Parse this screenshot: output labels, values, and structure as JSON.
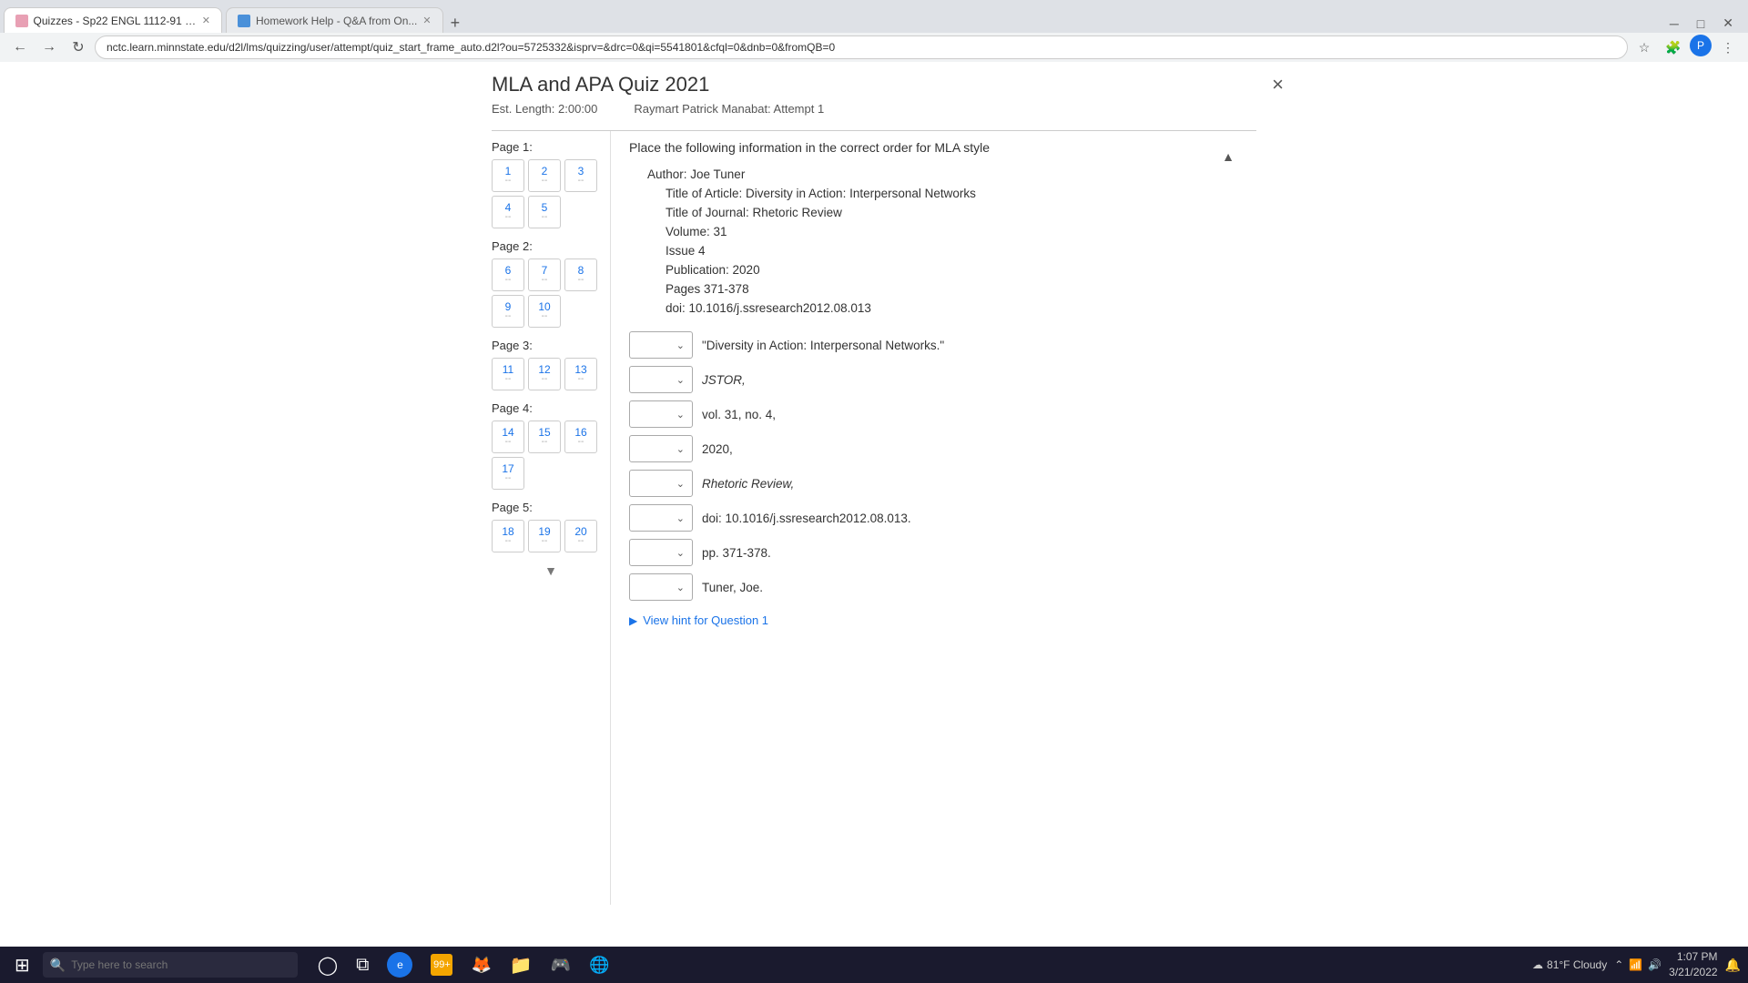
{
  "browser": {
    "tabs": [
      {
        "id": "tab1",
        "label": "Quizzes - Sp22 ENGL 1112-91 C...",
        "favicon": "quizzes",
        "active": true
      },
      {
        "id": "tab2",
        "label": "Homework Help - Q&A from On...",
        "favicon": "hw",
        "active": false
      }
    ],
    "address": "nctc.learn.minnstate.edu/d2l/lms/quizzing/user/attempt/quiz_start_frame_auto.d2l?ou=5725332&isprv=&drc=0&qi=5541801&cfql=0&dnb=0&fromQB=0",
    "new_tab_label": "+"
  },
  "quiz": {
    "title": "MLA and APA Quiz 2021",
    "est_length_label": "Est. Length:",
    "est_length_value": "2:00:00",
    "attempt_label": "Raymart Patrick Manabat: Attempt 1",
    "close_label": "×",
    "pages": [
      {
        "label": "Page 1:",
        "buttons": [
          {
            "num": "1",
            "dash": "--"
          },
          {
            "num": "2",
            "dash": "--"
          },
          {
            "num": "3",
            "dash": "--"
          },
          {
            "num": "4",
            "dash": "--"
          },
          {
            "num": "5",
            "dash": "--"
          }
        ]
      },
      {
        "label": "Page 2:",
        "buttons": [
          {
            "num": "6",
            "dash": "--"
          },
          {
            "num": "7",
            "dash": "--"
          },
          {
            "num": "8",
            "dash": "--"
          },
          {
            "num": "9",
            "dash": "--"
          },
          {
            "num": "10",
            "dash": "--"
          }
        ]
      },
      {
        "label": "Page 3:",
        "buttons": [
          {
            "num": "11",
            "dash": "--"
          },
          {
            "num": "12",
            "dash": "--"
          },
          {
            "num": "13",
            "dash": "--"
          }
        ]
      },
      {
        "label": "Page 4:",
        "buttons": [
          {
            "num": "14",
            "dash": "--"
          },
          {
            "num": "15",
            "dash": "--"
          },
          {
            "num": "16",
            "dash": "--"
          },
          {
            "num": "17",
            "dash": "--"
          }
        ]
      },
      {
        "label": "Page 5:",
        "buttons": [
          {
            "num": "18",
            "dash": "--"
          },
          {
            "num": "19",
            "dash": "--"
          },
          {
            "num": "20",
            "dash": "--"
          }
        ]
      }
    ],
    "question": {
      "text": "Place the following information in the correct order for MLA style",
      "info": [
        {
          "label": "Author: Joe Tuner",
          "indent": false
        },
        {
          "label": "Title of Article: Diversity in Action: Interpersonal Networks",
          "indent": true
        },
        {
          "label": "Title of Journal: Rhetoric Review",
          "indent": true
        },
        {
          "label": "Volume: 31",
          "indent": true
        },
        {
          "label": "Issue 4",
          "indent": true
        },
        {
          "label": "Publication: 2020",
          "indent": true
        },
        {
          "label": "Pages 371-378",
          "indent": true
        },
        {
          "label": "doi: 10.1016/j.ssresearch2012.08.013",
          "indent": true
        }
      ],
      "dropdowns": [
        {
          "value": "",
          "text": "\"Diversity in Action: Interpersonal Networks.\"",
          "italic": false
        },
        {
          "value": "",
          "text": "JSTOR,",
          "italic": true
        },
        {
          "value": "",
          "text": "vol. 31, no. 4,",
          "italic": false
        },
        {
          "value": "",
          "text": "2020,",
          "italic": false
        },
        {
          "value": "",
          "text": "Rhetoric Review,",
          "italic": true
        },
        {
          "value": "",
          "text": "doi: 10.1016/j.ssresearch2012.08.013.",
          "italic": false
        },
        {
          "value": "",
          "text": "pp. 371-378.",
          "italic": false
        },
        {
          "value": "",
          "text": "Tuner, Joe.",
          "italic": false
        }
      ],
      "hint_label": "View hint for Question 1"
    }
  },
  "taskbar": {
    "search_placeholder": "Type here to search",
    "weather": "81°F  Cloudy",
    "time": "1:07 PM",
    "date": "3/21/2022",
    "system_icons": [
      "chevron-up",
      "wifi",
      "speaker",
      "battery"
    ]
  }
}
